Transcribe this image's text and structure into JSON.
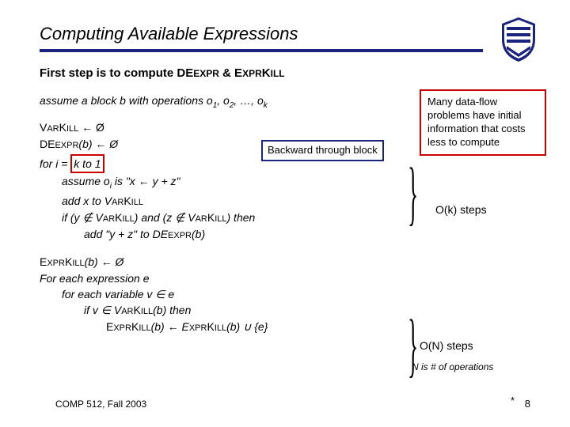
{
  "title": "Computing Available Expressions",
  "subtitle_parts": {
    "prefix": "First step is to compute DE",
    "expr1": "EXPR",
    "amp": " & E",
    "expr2": "XPR",
    "k": "K",
    "ill": "ILL"
  },
  "algo1": {
    "assume": "assume a block b with operations o",
    "assume_tail": ", …, o",
    "varkill_line_a": "V",
    "varkill_line_b": "AR",
    "varkill_line_c": "K",
    "varkill_line_d": "ILL",
    "arrow": " ← Ø",
    "deexpr_a": "DE",
    "deexpr_b": "EXPR",
    "deexpr_paren": "(b) ← Ø",
    "backward": "Backward through block",
    "for_a": "for i = ",
    "for_box": "k to 1",
    "l1_a": "assume o",
    "l1_b": " is \"x ← y + z\"",
    "l2": "add x to V",
    "l2b": "AR",
    "l2c": "K",
    "l2d": "ILL",
    "l3_a": "if (y ∉ V",
    "l3_b": "AR",
    "l3_c": "K",
    "l3_d": "ILL",
    "l3_e": ") and (z ∉ V",
    "l3_f": "AR",
    "l3_g": "K",
    "l3_h": "ILL",
    "l3_i": ") then",
    "l4": "add \"y + z\" to DE",
    "l4b": "EXPR",
    "l4c": "(b)"
  },
  "algo2": {
    "l0_a": "E",
    "l0_b": "XPR",
    "l0_c": "K",
    "l0_d": "ILL",
    "l0_e": "(b) ← Ø",
    "l1": "For each expression e",
    "l2": "for each variable v ∈ e",
    "l3_a": "if v ∈ V",
    "l3_b": "AR",
    "l3_c": "K",
    "l3_d": "ILL",
    "l3_e": "(b) then",
    "l4_a": "E",
    "l4_b": "XPR",
    "l4_c": "K",
    "l4_d": "ILL",
    "l4_e": "(b) ← E",
    "l4_f": "XPR",
    "l4_g": "K",
    "l4_h": "ILL",
    "l4_i": "(b) ∪ {e}"
  },
  "note": "Many data-flow problems have initial information that costs less to compute",
  "steps1": "O(k) steps",
  "steps2": "O(N) steps",
  "nisops": "N is # of operations",
  "footer_left": "COMP 512, Fall 2003",
  "footer_page": "8",
  "footer_star": "*"
}
